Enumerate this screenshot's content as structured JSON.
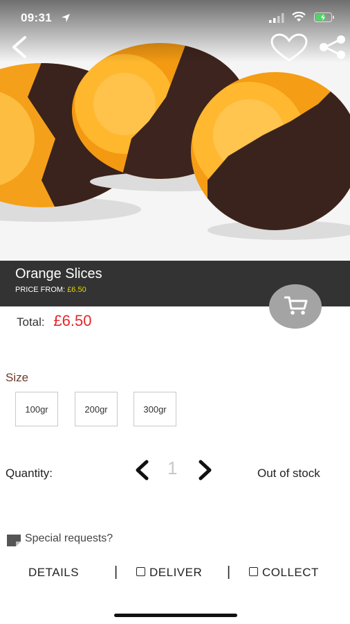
{
  "status_bar": {
    "time": "09:31"
  },
  "product": {
    "title": "Orange Slices",
    "price_from_label": "PRICE FROM:",
    "price_from_value": "£6.50",
    "total_label": "Total:",
    "total_value": "£6.50"
  },
  "size": {
    "label": "Size",
    "options": [
      "100gr",
      "200gr",
      "300gr"
    ]
  },
  "quantity": {
    "label": "Quantity:",
    "value": "1",
    "stock_status": "Out of stock"
  },
  "special_requests": {
    "label": "Special requests?"
  },
  "bottom": {
    "details": "DETAILS",
    "deliver": "DELIVER",
    "collect": "COLLECT",
    "separator": "|"
  },
  "icons": {
    "back": "back-arrow-icon",
    "favourite": "heart-icon",
    "share": "share-icon",
    "cart": "cart-icon"
  },
  "colors": {
    "title_bar": "#333333",
    "price_highlight": "#e6d800",
    "total_price": "#e3262b",
    "cart_button": "#a4a4a4",
    "size_label": "#6b3a2a"
  }
}
